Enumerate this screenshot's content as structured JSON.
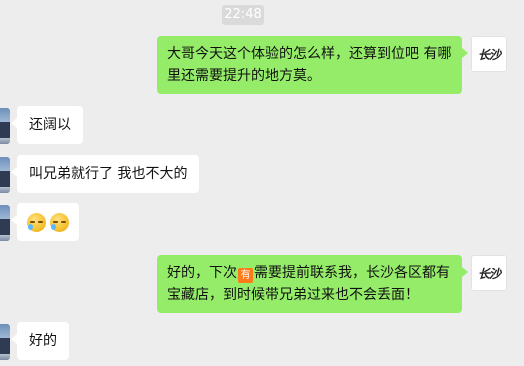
{
  "chat": {
    "timestamp": "22:48",
    "messages": [
      {
        "side": "right",
        "text": "大哥今天这个体验的怎么样，还算到位吧 有哪里还需要提升的地方莫。"
      },
      {
        "side": "left",
        "text": "还阔以"
      },
      {
        "side": "left",
        "text": "叫兄弟就行了 我也不大的"
      },
      {
        "side": "left",
        "emojis": [
          "sweat-smile-emoji",
          "sweat-smile-emoji"
        ]
      },
      {
        "side": "right",
        "text_before": "好的，下次",
        "badge": "有",
        "text_after": "需要提前联系我，长沙各区都有宝藏店，到时候带兄弟过来也不会丢面！"
      },
      {
        "side": "left",
        "text": "好的"
      }
    ]
  },
  "avatars": {
    "me": {
      "logo_text": "长沙"
    },
    "contact": {
      "icon": "landscape-avatar"
    }
  },
  "colors": {
    "background": "#ededed",
    "my_bubble": "#95ec69",
    "their_bubble": "#ffffff",
    "timestamp_bg": "#dadada",
    "badge": "#ff7a1a"
  }
}
